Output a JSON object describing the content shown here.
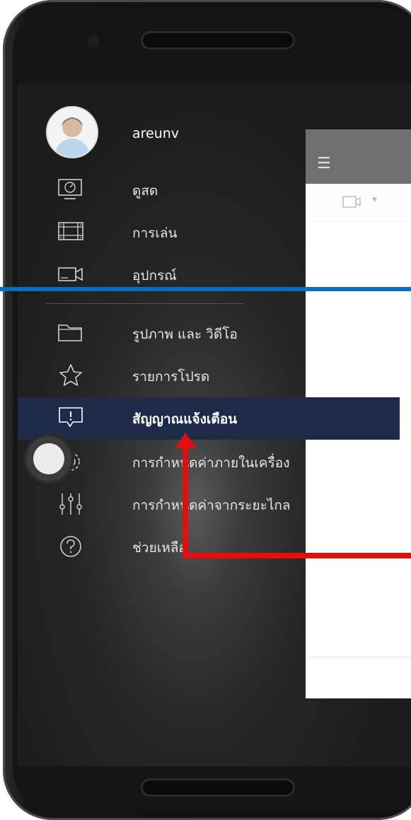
{
  "user": {
    "name": "areunv"
  },
  "menu": {
    "items": [
      {
        "label": "ดูสด",
        "icon": "monitor-icon"
      },
      {
        "label": "การเล่น",
        "icon": "film-icon"
      },
      {
        "label": "อุปกรณ์",
        "icon": "camera-icon"
      },
      {
        "label": "รูปภาพ และ วิดีโอ",
        "icon": "folder-icon"
      },
      {
        "label": "รายการโปรด",
        "icon": "star-icon"
      },
      {
        "label": "สัญญาณแจ้งเตือน",
        "icon": "alert-message-icon",
        "active": true
      },
      {
        "label": "การกำหนดค่าภายในเครื่อง",
        "icon": "gear-icon"
      },
      {
        "label": "การกำหนดค่าจากระยะไกล",
        "icon": "sliders-icon"
      },
      {
        "label": "ช่วยเหลือ",
        "icon": "help-icon"
      }
    ]
  },
  "content": {
    "header_icon": "hamburger-icon",
    "toolbar_icon": "video-camera-icon"
  },
  "colors": {
    "active_bg": "#1e2a4a",
    "annotation_red": "#e01010",
    "annotation_blue": "#0a6dbd"
  }
}
